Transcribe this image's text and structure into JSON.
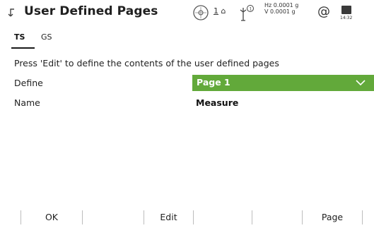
{
  "header": {
    "title": "User Defined Pages",
    "face": "1",
    "hz": "Hz 0.0001 g",
    "v": "V  0.0001 g",
    "at_symbol": "@",
    "time": "14:32"
  },
  "tabs": [
    {
      "label": "TS",
      "active": true
    },
    {
      "label": "GS",
      "active": false
    }
  ],
  "instruction": "Press 'Edit' to define the contents of the user defined pages",
  "fields": {
    "define": {
      "label": "Define",
      "value": "Page 1"
    },
    "name": {
      "label": "Name",
      "value": "Measure"
    }
  },
  "softkeys": {
    "f1": "OK",
    "f3": "Edit",
    "f6": "Page"
  },
  "colors": {
    "accent_green": "#62a93a"
  },
  "icons": [
    "back-arrow-icon",
    "compass-icon",
    "prism-icon",
    "battery-icon",
    "chevron-down-icon"
  ]
}
